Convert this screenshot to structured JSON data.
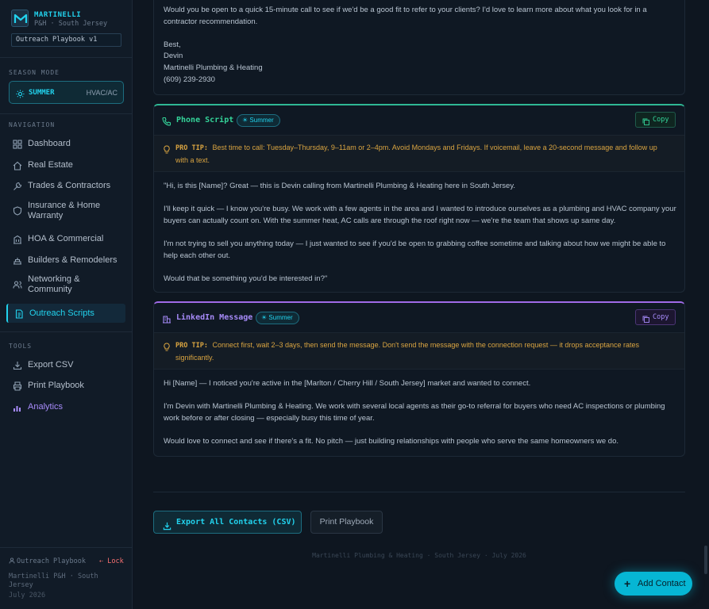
{
  "brand": {
    "title": "MARTINELLI",
    "subtitle": "P&H · South Jersey",
    "badge": "Outreach Playbook v1"
  },
  "season": {
    "section_label": "SEASON MODE",
    "mode": "SUMMER",
    "sub": "HVAC/AC"
  },
  "nav": {
    "section_label": "NAVIGATION",
    "items": [
      {
        "label": "Dashboard",
        "icon": "grid-icon"
      },
      {
        "label": "Real Estate",
        "icon": "home-icon"
      },
      {
        "label": "Trades & Contractors",
        "icon": "wrench-icon"
      },
      {
        "label": "Insurance & Home Warranty",
        "icon": "shield-icon"
      },
      {
        "label": "HOA & Commercial",
        "icon": "building-icon"
      },
      {
        "label": "Builders & Remodelers",
        "icon": "hammer-icon"
      },
      {
        "label": "Networking & Community",
        "icon": "users-icon"
      },
      {
        "label": "Outreach Scripts",
        "icon": "document-icon"
      }
    ]
  },
  "tools": {
    "section_label": "TOOLS",
    "items": [
      {
        "label": "Export CSV",
        "icon": "download-icon"
      },
      {
        "label": "Print Playbook",
        "icon": "printer-icon"
      },
      {
        "label": "Analytics",
        "icon": "bar-chart-icon"
      }
    ]
  },
  "sidebar_footer": {
    "playbook": "Outreach Playbook",
    "lock": "Lock",
    "company": "Martinelli P&H · South Jersey",
    "date": "July 2026"
  },
  "email_card": {
    "lines": [
      "Would you be open to a quick 15-minute call to see if we'd be a good fit to refer to your clients? I'd love to learn more about what you look for in a contractor recommendation.",
      "Best,",
      "Devin",
      "Martinelli Plumbing & Heating",
      "(609) 239-2930"
    ]
  },
  "phone_card": {
    "title": "Phone Script",
    "tag": "Summer",
    "copy": "Copy",
    "tip_label": "PRO TIP:",
    "tip": "Best time to call: Tuesday–Thursday, 9–11am or 2–4pm. Avoid Mondays and Fridays. If voicemail, leave a 20-second message and follow up with a text.",
    "paragraphs": [
      "\"Hi, is this [Name]? Great — this is Devin calling from Martinelli Plumbing & Heating here in South Jersey.",
      "I'll keep it quick — I know you're busy. We work with a few agents in the area and I wanted to introduce ourselves as a plumbing and HVAC company your buyers can actually count on. With the summer heat, AC calls are through the roof right now — we're the team that shows up same day.",
      "I'm not trying to sell you anything today — I just wanted to see if you'd be open to grabbing coffee sometime and talking about how we might be able to help each other out.",
      "Would that be something you'd be interested in?\""
    ]
  },
  "linkedin_card": {
    "title": "LinkedIn Message",
    "tag": "Summer",
    "copy": "Copy",
    "tip_label": "PRO TIP:",
    "tip": "Connect first, wait 2–3 days, then send the message. Don't send the message with the connection request — it drops acceptance rates significantly.",
    "paragraphs": [
      "Hi [Name] — I noticed you're active in the [Marlton / Cherry Hill / South Jersey] market and wanted to connect.",
      "I'm Devin with Martinelli Plumbing & Heating. We work with several local agents as their go-to referral for buyers who need AC inspections or plumbing work before or after closing — especially busy this time of year.",
      "Would love to connect and see if there's a fit. No pitch — just building relationships with people who serve the same homeowners we do."
    ]
  },
  "actions": {
    "export": "Export All Contacts (CSV)",
    "print": "Print Playbook"
  },
  "footer": "Martinelli Plumbing & Heating · South Jersey · July 2026",
  "fab": "Add Contact",
  "colors": {
    "accent_cyan": "#22d3ee",
    "phone_green": "#34d399",
    "linkedin_purple": "#a78bfa",
    "tip_amber": "#d9a441",
    "danger": "#f87171"
  }
}
